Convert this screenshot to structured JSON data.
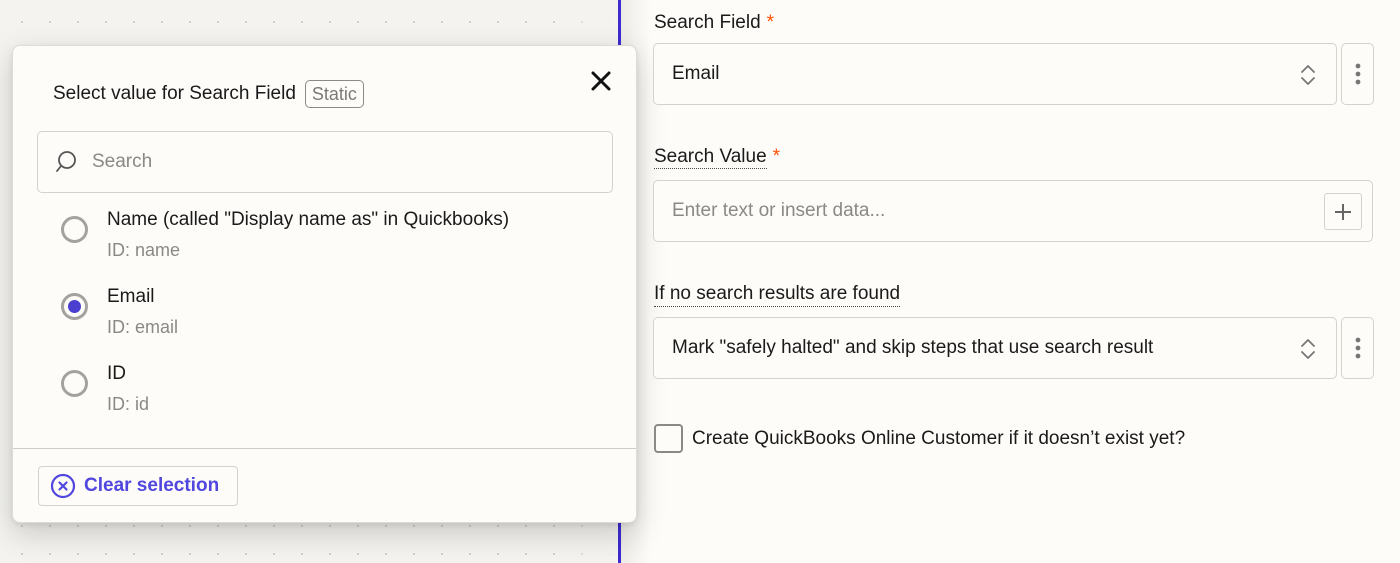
{
  "popover": {
    "title": "Select value for Search Field",
    "badge": "Static",
    "close_icon": "close-icon",
    "search": {
      "placeholder": "Search",
      "value": "",
      "icon": "search-icon"
    },
    "options": [
      {
        "label": "Name (called \"Display name as\" in Quickbooks)",
        "id_text": "ID: name",
        "selected": false
      },
      {
        "label": "Email",
        "id_text": "ID: email",
        "selected": true
      },
      {
        "label": "ID",
        "id_text": "ID: id",
        "selected": false
      }
    ],
    "clear_button": {
      "label": "Clear selection",
      "icon": "clear-circle-x-icon"
    }
  },
  "form": {
    "search_field": {
      "label": "Search Field",
      "required_mark": "*",
      "value": "Email"
    },
    "search_value": {
      "label": "Search Value",
      "required_mark": "*",
      "placeholder": "Enter text or insert data...",
      "value": ""
    },
    "no_results": {
      "label": "If no search results are found",
      "value": "Mark \"safely halted\" and skip steps that use search result"
    },
    "create_checkbox": {
      "label": "Create QuickBooks Online Customer if it doesn’t exist yet?",
      "checked": false
    }
  },
  "colors": {
    "accent": "#4a3fcf",
    "link": "#5147de",
    "required": "#ff4f00",
    "divider": "#3d2bd1"
  }
}
